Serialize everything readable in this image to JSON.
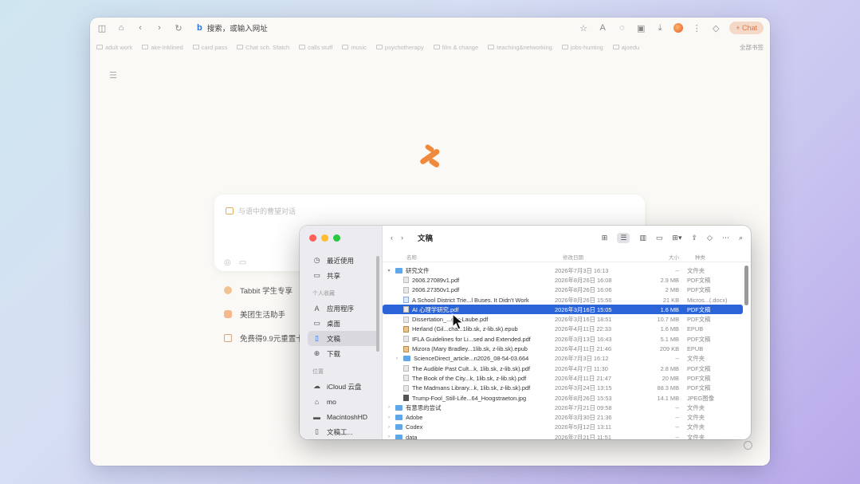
{
  "toolbar": {
    "url_text": "搜索，或输入网址",
    "chat_label": "+ Chat"
  },
  "bookmarks": {
    "items": [
      "adult work",
      "ake-Inklined",
      "card pass",
      "Chat sch. Sfatch",
      "calls stuff",
      "music",
      "psychotherapy",
      "film & change",
      "teaching&networking",
      "jobs-hunting",
      "ajoedu"
    ],
    "other": "全部书签"
  },
  "chat": {
    "placeholder": "与语中的曹望对话"
  },
  "promos": [
    {
      "label": "Tabbit 学生专享"
    },
    {
      "label": "美团生活助手"
    },
    {
      "label": "免费得9.9元重置卡"
    }
  ],
  "finder": {
    "title": "文稿",
    "sidebar": {
      "items_top": [
        {
          "label": "最近使用",
          "icon": "clock-icon"
        },
        {
          "label": "共享",
          "icon": "shared-folder-icon"
        }
      ],
      "section_personal": "个人收藏",
      "items_personal": [
        {
          "label": "应用程序",
          "icon": "apps-icon"
        },
        {
          "label": "桌面",
          "icon": "desktop-icon"
        },
        {
          "label": "文稿",
          "icon": "document-icon",
          "selected": true
        },
        {
          "label": "下载",
          "icon": "download-icon"
        }
      ],
      "section_location": "位置",
      "items_location": [
        {
          "label": "iCloud 云盘",
          "icon": "cloud-icon"
        },
        {
          "label": "mo",
          "icon": "home-icon"
        },
        {
          "label": "MacintoshHD",
          "icon": "disk-icon"
        },
        {
          "label": "文稿工...",
          "icon": "document-icon"
        }
      ]
    },
    "columns": {
      "name": "名称",
      "date": "修改日期",
      "size": "大小",
      "kind": "种类"
    },
    "rows": [
      {
        "caret": "▾",
        "indent": 0,
        "icon": "folder",
        "name": "研究文件",
        "date": "2026年7月3日 16:13",
        "size": "--",
        "kind": "文件夹"
      },
      {
        "caret": "",
        "indent": 1,
        "icon": "pdf",
        "name": "2606.27089v1.pdf",
        "date": "2026年8月26日 16:08",
        "size": "2.9 MB",
        "kind": "PDF文稿"
      },
      {
        "caret": "",
        "indent": 1,
        "icon": "pdf",
        "name": "2606.27350v1.pdf",
        "date": "2026年8月26日 16:06",
        "size": "2 MB",
        "kind": "PDF文稿"
      },
      {
        "caret": "",
        "indent": 1,
        "icon": "doc",
        "name": "A School District Trie...l Buses. It Didn't Work",
        "date": "2026年8月26日 15:56",
        "size": "21 KB",
        "kind": "Micros...(.docx)"
      },
      {
        "caret": "",
        "indent": 1,
        "icon": "pdf",
        "name": "AI 心理学研究.pdf",
        "date": "2026年3月16日 15:05",
        "size": "1.6 MB",
        "kind": "PDF文稿",
        "selected": true
      },
      {
        "caret": "",
        "indent": 1,
        "icon": "pdf",
        "name": "Dissertation_...ger-Laube.pdf",
        "date": "2026年3月16日 18:51",
        "size": "10.7 MB",
        "kind": "PDF文稿"
      },
      {
        "caret": "",
        "indent": 1,
        "icon": "epub",
        "name": "Herland (Gil...cha...1lib.sk, z-lib.sk).epub",
        "date": "2026年4月11日 22:33",
        "size": "1.6 MB",
        "kind": "EPUB"
      },
      {
        "caret": "",
        "indent": 1,
        "icon": "pdf",
        "name": "IFLA Guidelines for Li...sed and Extended.pdf",
        "date": "2026年3月13日 16:43",
        "size": "5.1 MB",
        "kind": "PDF文稿"
      },
      {
        "caret": "",
        "indent": 1,
        "icon": "epub",
        "name": "Mizora (Mary Bradley...1lib.sk, z-lib.sk).epub",
        "date": "2026年4月11日 21:46",
        "size": "209 KB",
        "kind": "EPUB"
      },
      {
        "caret": "›",
        "indent": 1,
        "icon": "folder",
        "name": "ScienceDirect_article...n2026_08-54-03.664",
        "date": "2026年7月3日 16:12",
        "size": "--",
        "kind": "文件夹"
      },
      {
        "caret": "",
        "indent": 1,
        "icon": "pdf",
        "name": "The Audible Past Cult...k, 1lib.sk, z-lib.sk).pdf",
        "date": "2026年4月7日 11:30",
        "size": "2.8 MB",
        "kind": "PDF文稿"
      },
      {
        "caret": "",
        "indent": 1,
        "icon": "pdf",
        "name": "The Book of the City...k, 1lib.sk, z-lib.sk).pdf",
        "date": "2026年4月11日 21:47",
        "size": "20 MB",
        "kind": "PDF文稿"
      },
      {
        "caret": "",
        "indent": 1,
        "icon": "pdf",
        "name": "The Madmans Library...k, 1lib.sk, z-lib.sk).pdf",
        "date": "2026年3月24日 13:15",
        "size": "88.3 MB",
        "kind": "PDF文稿"
      },
      {
        "caret": "",
        "indent": 1,
        "icon": "img",
        "name": "Trump-Fool_Still-Life...64_Hoogstraeton.jpg",
        "date": "2026年8月26日 15:53",
        "size": "14.1 MB",
        "kind": "JPEG图像"
      },
      {
        "caret": "›",
        "indent": 0,
        "icon": "folder",
        "name": "有意思的尝试",
        "date": "2026年7月21日 09:58",
        "size": "--",
        "kind": "文件夹"
      },
      {
        "caret": "›",
        "indent": 0,
        "icon": "folder",
        "name": "Adobe",
        "date": "2026年3月30日 21:36",
        "size": "--",
        "kind": "文件夹"
      },
      {
        "caret": "›",
        "indent": 0,
        "icon": "folder",
        "name": "Codex",
        "date": "2026年5月12日 13:11",
        "size": "--",
        "kind": "文件夹"
      },
      {
        "caret": "›",
        "indent": 0,
        "icon": "folder",
        "name": "data",
        "date": "2026年7月21日 11:51",
        "size": "--",
        "kind": "文件夹"
      }
    ]
  }
}
